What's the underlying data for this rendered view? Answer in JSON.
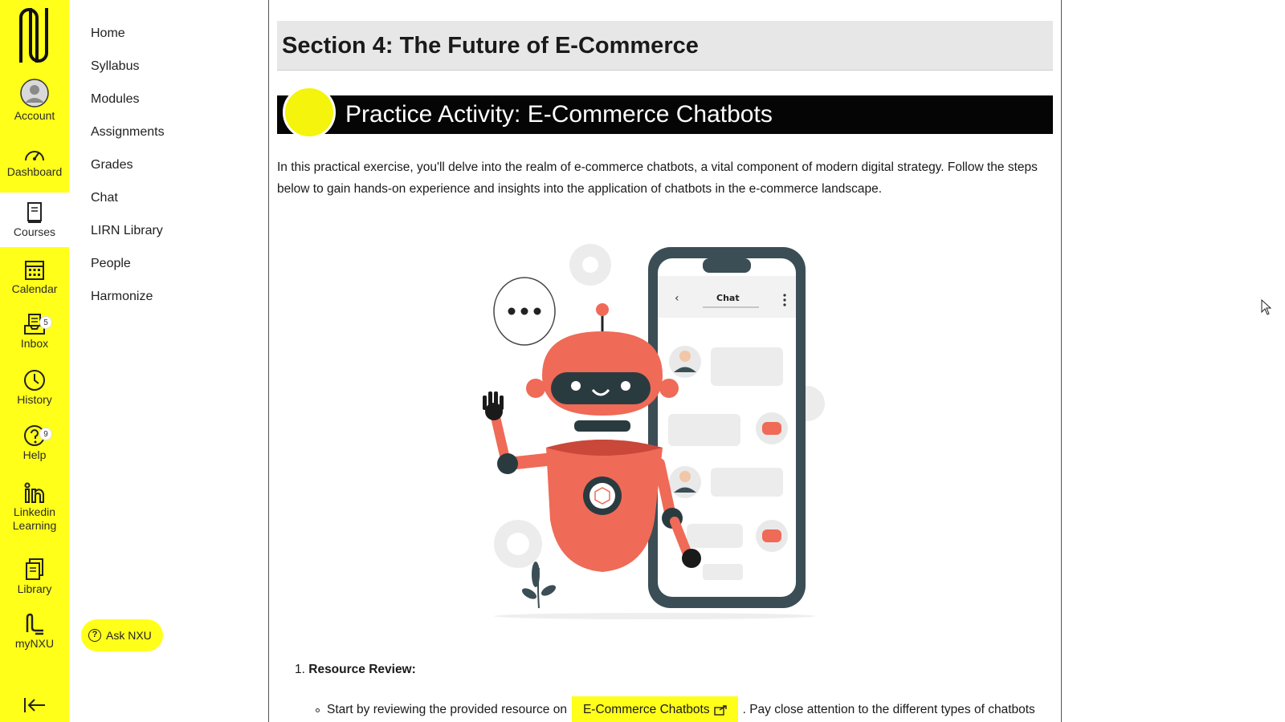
{
  "global_nav": {
    "items": [
      {
        "label": "Account",
        "icon": "account-avatar-icon"
      },
      {
        "label": "Dashboard",
        "icon": "dashboard-gauge-icon"
      },
      {
        "label": "Courses",
        "icon": "courses-book-icon"
      },
      {
        "label": "Calendar",
        "icon": "calendar-icon"
      },
      {
        "label": "Inbox",
        "icon": "inbox-icon",
        "badge": "5"
      },
      {
        "label": "History",
        "icon": "history-clock-icon"
      },
      {
        "label": "Help",
        "icon": "help-question-icon",
        "badge": "9"
      },
      {
        "label": "Linkedin",
        "label2": "Learning",
        "icon": "linkedin-icon"
      },
      {
        "label": "Library",
        "icon": "library-icon"
      },
      {
        "label": "myNXU",
        "icon": "mynxu-icon"
      }
    ],
    "accent": "#ffff1a"
  },
  "course_nav": {
    "links": [
      "Home",
      "Syllabus",
      "Modules",
      "Assignments",
      "Grades",
      "Chat",
      "LIRN Library",
      "People",
      "Harmonize"
    ],
    "ask_button": "Ask NXU"
  },
  "content": {
    "section_title": "Section 4: The Future of E-Commerce",
    "activity_title": "Practice Activity: E-Commerce Chatbots",
    "intro": "In this practical exercise, you'll delve into the realm of e-commerce chatbots, a vital component of modern digital strategy. Follow the steps below to gain hands-on experience and insights into the application of chatbots in the e-commerce landscape.",
    "illustration": {
      "phone_header": "Chat"
    },
    "step1_number": "1.",
    "step1_title": "Resource Review:",
    "step1_bullet_before": "Start by reviewing the provided resource on",
    "step1_link": "E-Commerce Chatbots",
    "step1_bullet_after": ". Pay close attention to the different types of chatbots"
  }
}
